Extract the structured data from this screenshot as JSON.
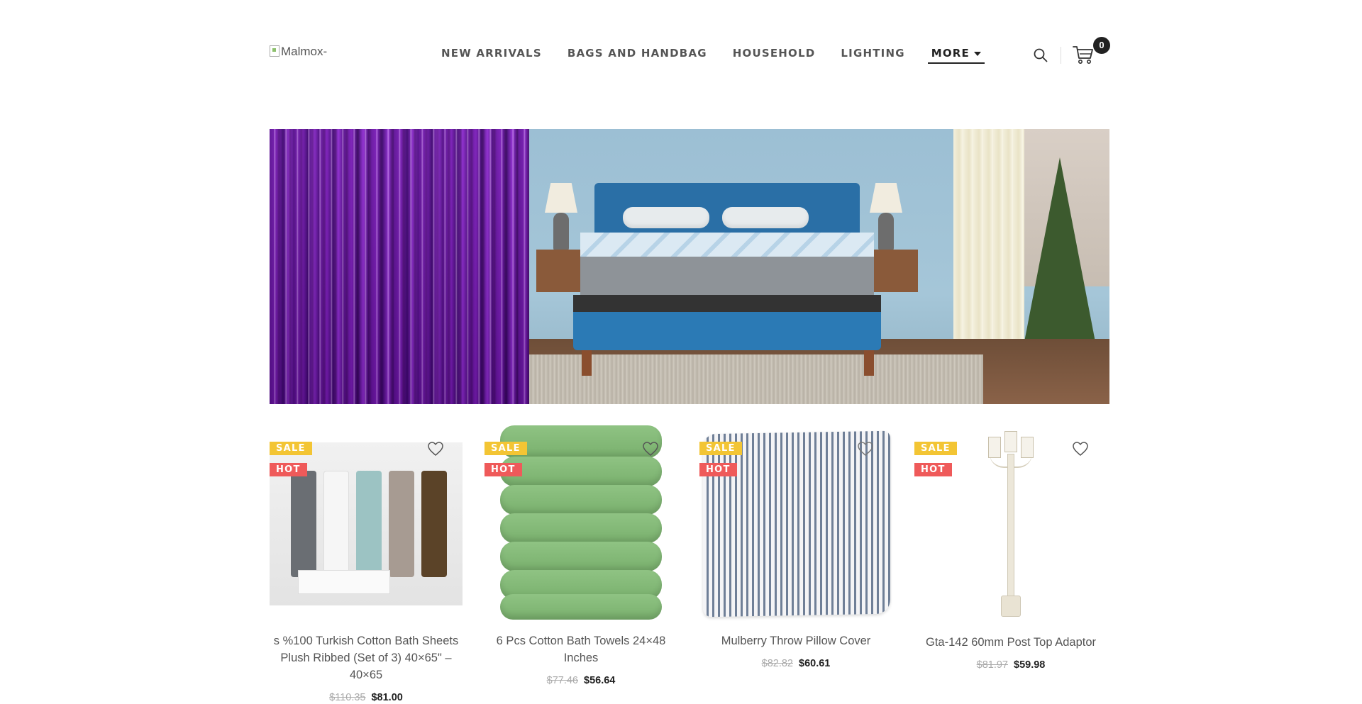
{
  "header": {
    "logo_alt": "Malmox-",
    "nav": [
      {
        "label": "NEW ARRIVALS"
      },
      {
        "label": "BAGS AND HANDBAG"
      },
      {
        "label": "HOUSEHOLD"
      },
      {
        "label": "LIGHTING"
      },
      {
        "label": "MORE"
      }
    ],
    "cart_count": "0"
  },
  "badges": {
    "sale": "SALE",
    "hot": "HOT"
  },
  "products": [
    {
      "title": "s %100 Turkish Cotton Bath Sheets Plush Ribbed (Set of 3) 40×65\" – 40×65",
      "old_price": "$110.35",
      "new_price": "$81.00"
    },
    {
      "title": "6 Pcs Cotton Bath Towels 24×48 Inches",
      "old_price": "$77.46",
      "new_price": "$56.64"
    },
    {
      "title": "Mulberry Throw Pillow Cover",
      "old_price": "$82.82",
      "new_price": "$60.61"
    },
    {
      "title": "Gta-142 60mm Post Top Adaptor",
      "old_price": "$81.97",
      "new_price": "$59.98"
    }
  ],
  "icons": {
    "search": "search-icon",
    "cart": "cart-icon",
    "wishlist": "heart-icon",
    "dropdown": "chevron-down-icon"
  },
  "colors": {
    "sale_badge": "#f3c534",
    "hot_badge": "#ef5a5a",
    "text_dark": "#222222",
    "text_muted": "#555555"
  }
}
